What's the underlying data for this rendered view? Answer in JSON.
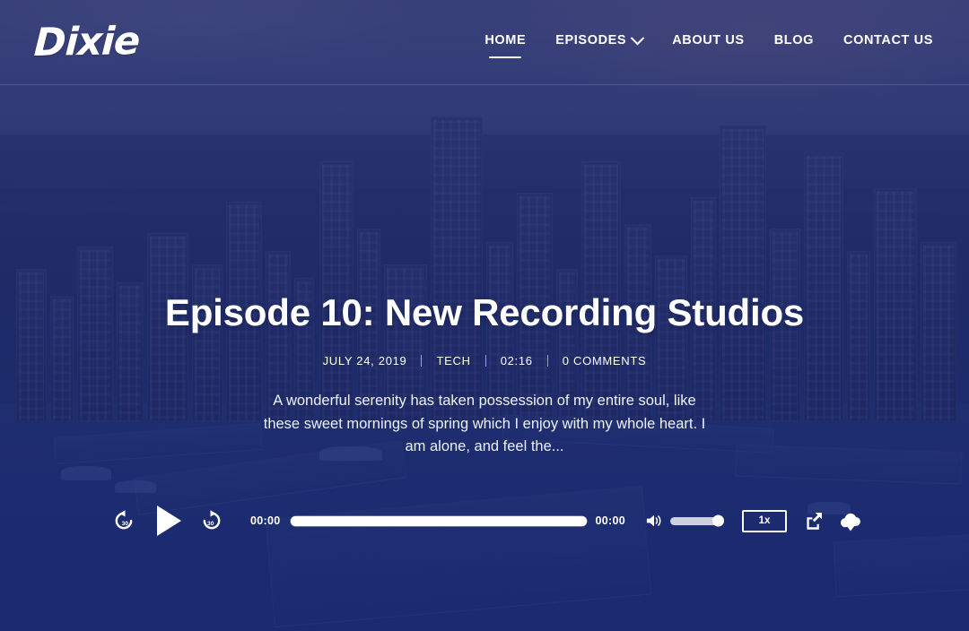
{
  "site": {
    "logo_text": "Dixie",
    "accent_color": "#ffffff",
    "overlay_color": "#2b4494",
    "background_color": "#27377a"
  },
  "nav": {
    "items": [
      {
        "label": "HOME",
        "active": true,
        "has_dropdown": false
      },
      {
        "label": "EPISODES",
        "active": false,
        "has_dropdown": true,
        "dropdown_icon": "chevron-down-icon"
      },
      {
        "label": "ABOUT US",
        "active": false,
        "has_dropdown": false
      },
      {
        "label": "BLOG",
        "active": false,
        "has_dropdown": false
      },
      {
        "label": "CONTACT US",
        "active": false,
        "has_dropdown": false
      }
    ]
  },
  "hero": {
    "title": "Episode 10: New Recording Studios",
    "meta": {
      "date": "JULY 24, 2019",
      "category": "TECH",
      "duration": "02:16",
      "comments": "0 COMMENTS"
    },
    "description": "A wonderful serenity has taken possession of my entire soul, like these sweet mornings of spring which I enjoy with my whole heart. I am alone, and feel the..."
  },
  "player": {
    "rewind_label": "30",
    "rewind_icon": "rewind-30-icon",
    "play_icon": "play-icon",
    "forward_label": "30",
    "forward_icon": "forward-30-icon",
    "current_time": "00:00",
    "total_time": "00:00",
    "progress_percent": 0,
    "volume_icon": "volume-icon",
    "volume_percent": 100,
    "speed_label": "1x",
    "share_icon": "share-external-icon",
    "download_icon": "cloud-download-icon"
  }
}
